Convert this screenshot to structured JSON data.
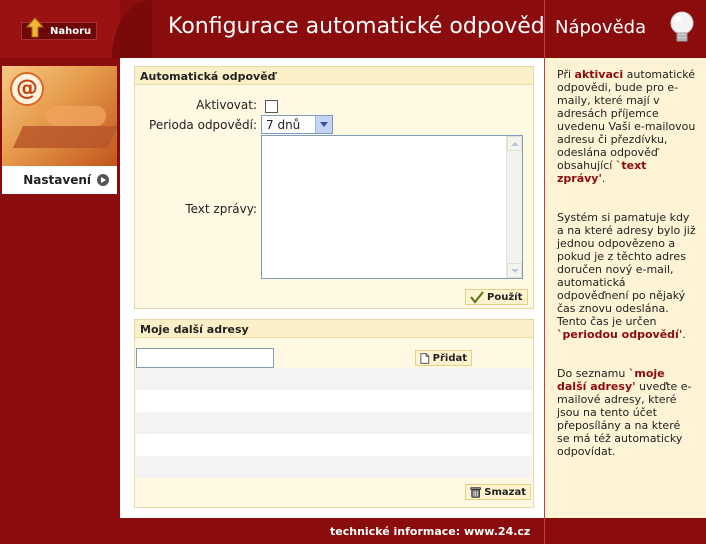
{
  "header": {
    "back_label": "Nahoru",
    "title": "Konfigurace automatické odpovědi",
    "help_title": "Nápověda"
  },
  "sidebar": {
    "active_item": "Nastavení"
  },
  "auto_reply": {
    "section_title": "Automatická odpověď",
    "activate_label": "Aktivovat:",
    "activate_checked": false,
    "period_label": "Perioda odpovědí:",
    "period_value": "7 dnů",
    "text_label": "Text zprávy:",
    "text_value": "",
    "apply_label": "Použít"
  },
  "other_addresses": {
    "section_title": "Moje další adresy",
    "address_value": "",
    "add_label": "Přidat",
    "delete_label": "Smazat"
  },
  "help": {
    "p1": [
      "Při ",
      "aktivaci",
      " automatické odpovědi, bude pro e-maily, které mají v adresách příjemce uvedenu Vaši e-mailovou adresu či přezdívku, odeslána odpověď obsahující ",
      "`text zprávy'",
      "."
    ],
    "p2": [
      "Systém si pamatuje kdy a na které adresy bylo již jednou odpovězeno a pokud je z těchto adres doručen nový e-mail, automatická odpověďnení po nějaký čas znovu odeslána. Tento čas je určen ",
      "`periodou odpovědí'",
      "."
    ],
    "p3": [
      "Do seznamu ",
      "`moje další adresy'",
      " uveďte e-mailové adresy, které jsou na tento účet přeposílány a na které se má též automaticky odpovídat."
    ]
  },
  "footer": {
    "text": "technické informace: www.24.cz"
  },
  "colors": {
    "brand": "#8a0c0c",
    "panel_bg": "#fff8e2",
    "help_bg": "#fff3d6"
  }
}
